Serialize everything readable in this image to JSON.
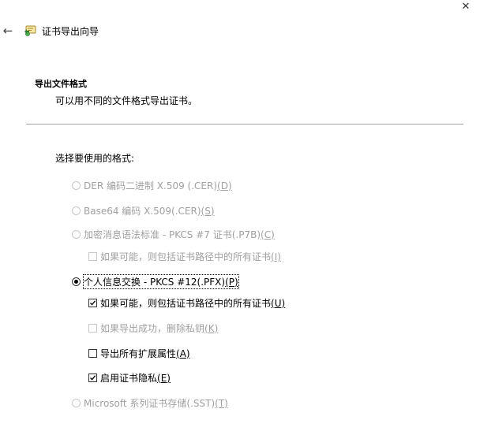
{
  "window": {
    "title": "证书导出向导",
    "close_glyph": "✕",
    "back_glyph": "←"
  },
  "section": {
    "heading": "导出文件格式",
    "description": "可以用不同的文件格式导出证书。"
  },
  "prompt": "选择要使用的格式:",
  "options": [
    {
      "label": "DER 编码二进制 X.509 (.CER)",
      "mnemonic": "(D)",
      "type": "radio",
      "checked": false,
      "enabled": false
    },
    {
      "label": "Base64 编码 X.509(.CER)",
      "mnemonic": "(S)",
      "type": "radio",
      "checked": false,
      "enabled": false
    },
    {
      "label": "加密消息语法标准 - PKCS #7 证书(.P7B)",
      "mnemonic": "(C)",
      "type": "radio",
      "checked": false,
      "enabled": false
    },
    {
      "label": "如果可能，则包括证书路径中的所有证书",
      "mnemonic": "(I)",
      "type": "checkbox",
      "checked": false,
      "enabled": false
    },
    {
      "label": "个人信息交换 - PKCS #12(.PFX)",
      "mnemonic": "(P)",
      "type": "radio",
      "checked": true,
      "enabled": true
    },
    {
      "label": "如果可能，则包括证书路径中的所有证书",
      "mnemonic": "(U)",
      "type": "checkbox",
      "checked": true,
      "enabled": true
    },
    {
      "label": "如果导出成功，删除私钥",
      "mnemonic": "(K)",
      "type": "checkbox",
      "checked": false,
      "enabled": false
    },
    {
      "label": "导出所有扩展属性",
      "mnemonic": "(A)",
      "type": "checkbox",
      "checked": false,
      "enabled": true
    },
    {
      "label": "启用证书隐私",
      "mnemonic": "(E)",
      "type": "checkbox",
      "checked": true,
      "enabled": true
    },
    {
      "label": "Microsoft 系列证书存储(.SST)",
      "mnemonic": "(T)",
      "type": "radio",
      "checked": false,
      "enabled": false
    }
  ]
}
